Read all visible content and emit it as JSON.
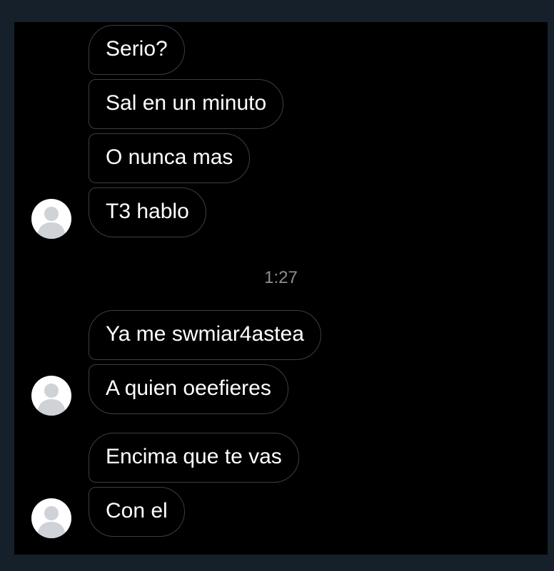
{
  "colors": {
    "background": "#000000",
    "outer_background": "#15202b",
    "bubble_border": "#3b3f44",
    "text": "#ffffff",
    "timestamp": "#8b8f94",
    "avatar": "#ffffff",
    "avatar_silhouette": "#cfd2d6"
  },
  "conversation": {
    "group1": {
      "messages": [
        "Serio?",
        "Sal en un minuto",
        "O nunca mas",
        "T3 hablo"
      ],
      "avatar_icon": "default-user-icon"
    },
    "timestamp": "1:27",
    "group2": {
      "messages": [
        "Ya me swmiar4astea",
        "A quien oeefieres"
      ],
      "avatar_icon": "default-user-icon"
    },
    "group3": {
      "messages": [
        "Encima que te vas",
        "Con el"
      ],
      "avatar_icon": "default-user-icon"
    }
  }
}
